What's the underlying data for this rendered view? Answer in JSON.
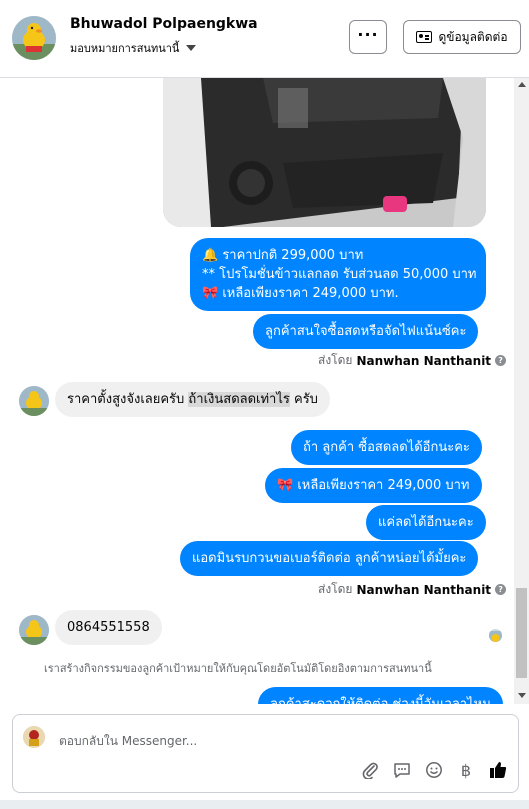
{
  "header": {
    "name": "Bhuwadol Polpaengkwa",
    "subtitle": "มอบหมายการสนทนานี้",
    "more_label": "···",
    "contact_label": "ดูข้อมูลติดต่อ"
  },
  "messages": {
    "out1_line1": "🔔 ราคาปกติ  299,000 บาท",
    "out1_line2": "** โปรโมชั่นข้าวแลกลด รับส่วนลด 50,000 บาท",
    "out1_line3": "🎀  เหลือเพียงราคา 249,000 บาท.",
    "out2": "ลูกค้าสนใจซื้อสดหรือจัดไฟแน้นซ์คะ",
    "sent_by_prefix": "ส่งโดย",
    "sent_by_name": "Nanwhan Nanthanit",
    "in1_part1": "ราคาตั้งสูงจังเลยครับ ",
    "in1_highlight": "ถ้าเงินสดลดเท่าไร",
    "in1_part2": " ครับ",
    "out3": "ถ้า ลูกค้า ซื้อสดลดได้อีกนะคะ",
    "out4": "🎀  เหลือเพียงราคา 249,000 บาท",
    "out5": "แค่ลดได้อีกนะคะ",
    "out6": "แอดมินรบกวนขอเบอร์ติดต่อ ลูกค้าหน่อยได้มั้ยคะ",
    "in2": "0864551558",
    "notice": "เราสร้างกิจกรรมของลูกค้าเป้าหมายให้กับคุณโดยอัตโนมัติโดยอิงตามการสนทนานี้",
    "out7_partial": "ลูกค้าสะดวกให้ติดต่อ ช่วงนี้วันเวลาไหน"
  },
  "composer": {
    "placeholder": "ตอบกลับใน Messenger..."
  },
  "colors": {
    "accent": "#0084ff",
    "incoming_bubble": "#f0f0f0",
    "like": "#050505"
  },
  "icons": [
    "more-icon",
    "contact-card-icon",
    "paperclip-icon",
    "chat-bubble-icon",
    "emoji-icon",
    "currency-icon",
    "thumbs-up-icon",
    "question-icon"
  ]
}
